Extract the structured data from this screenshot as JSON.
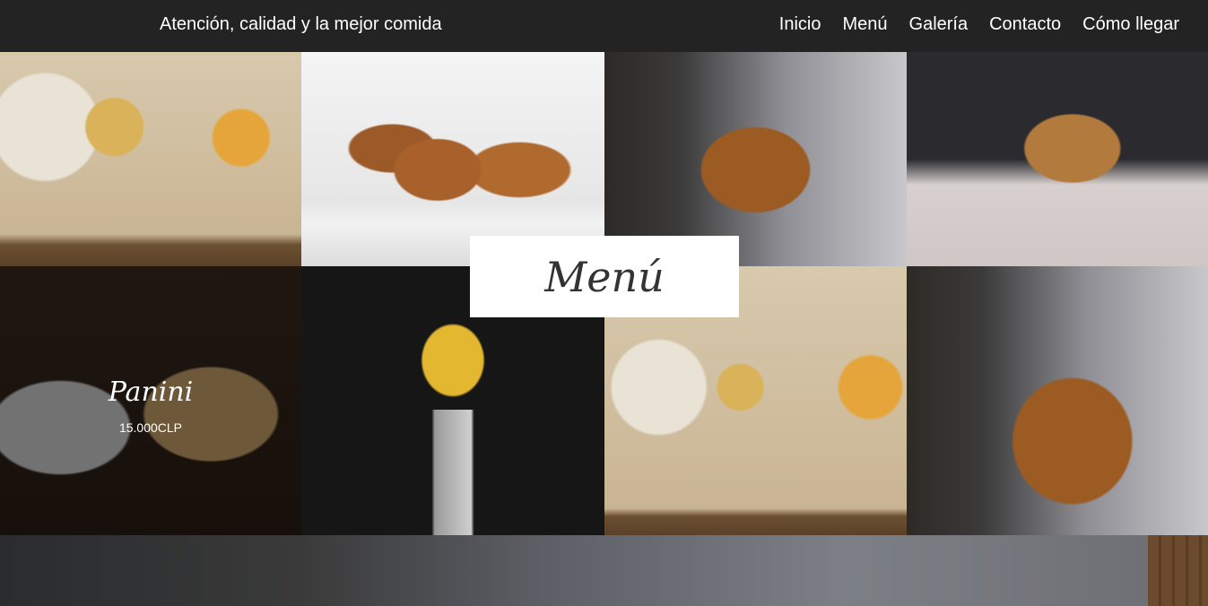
{
  "header": {
    "tagline": "Atención, calidad y la mejor comida",
    "nav": [
      {
        "label": "Inicio"
      },
      {
        "label": "Menú"
      },
      {
        "label": "Galería"
      },
      {
        "label": "Contacto"
      },
      {
        "label": "Cómo llegar"
      }
    ]
  },
  "section_title": "Menú",
  "featured_item": {
    "name": "Panini",
    "price": "15.000CLP"
  },
  "colors": {
    "nav_bg": "#232323",
    "text": "#ffffff"
  }
}
